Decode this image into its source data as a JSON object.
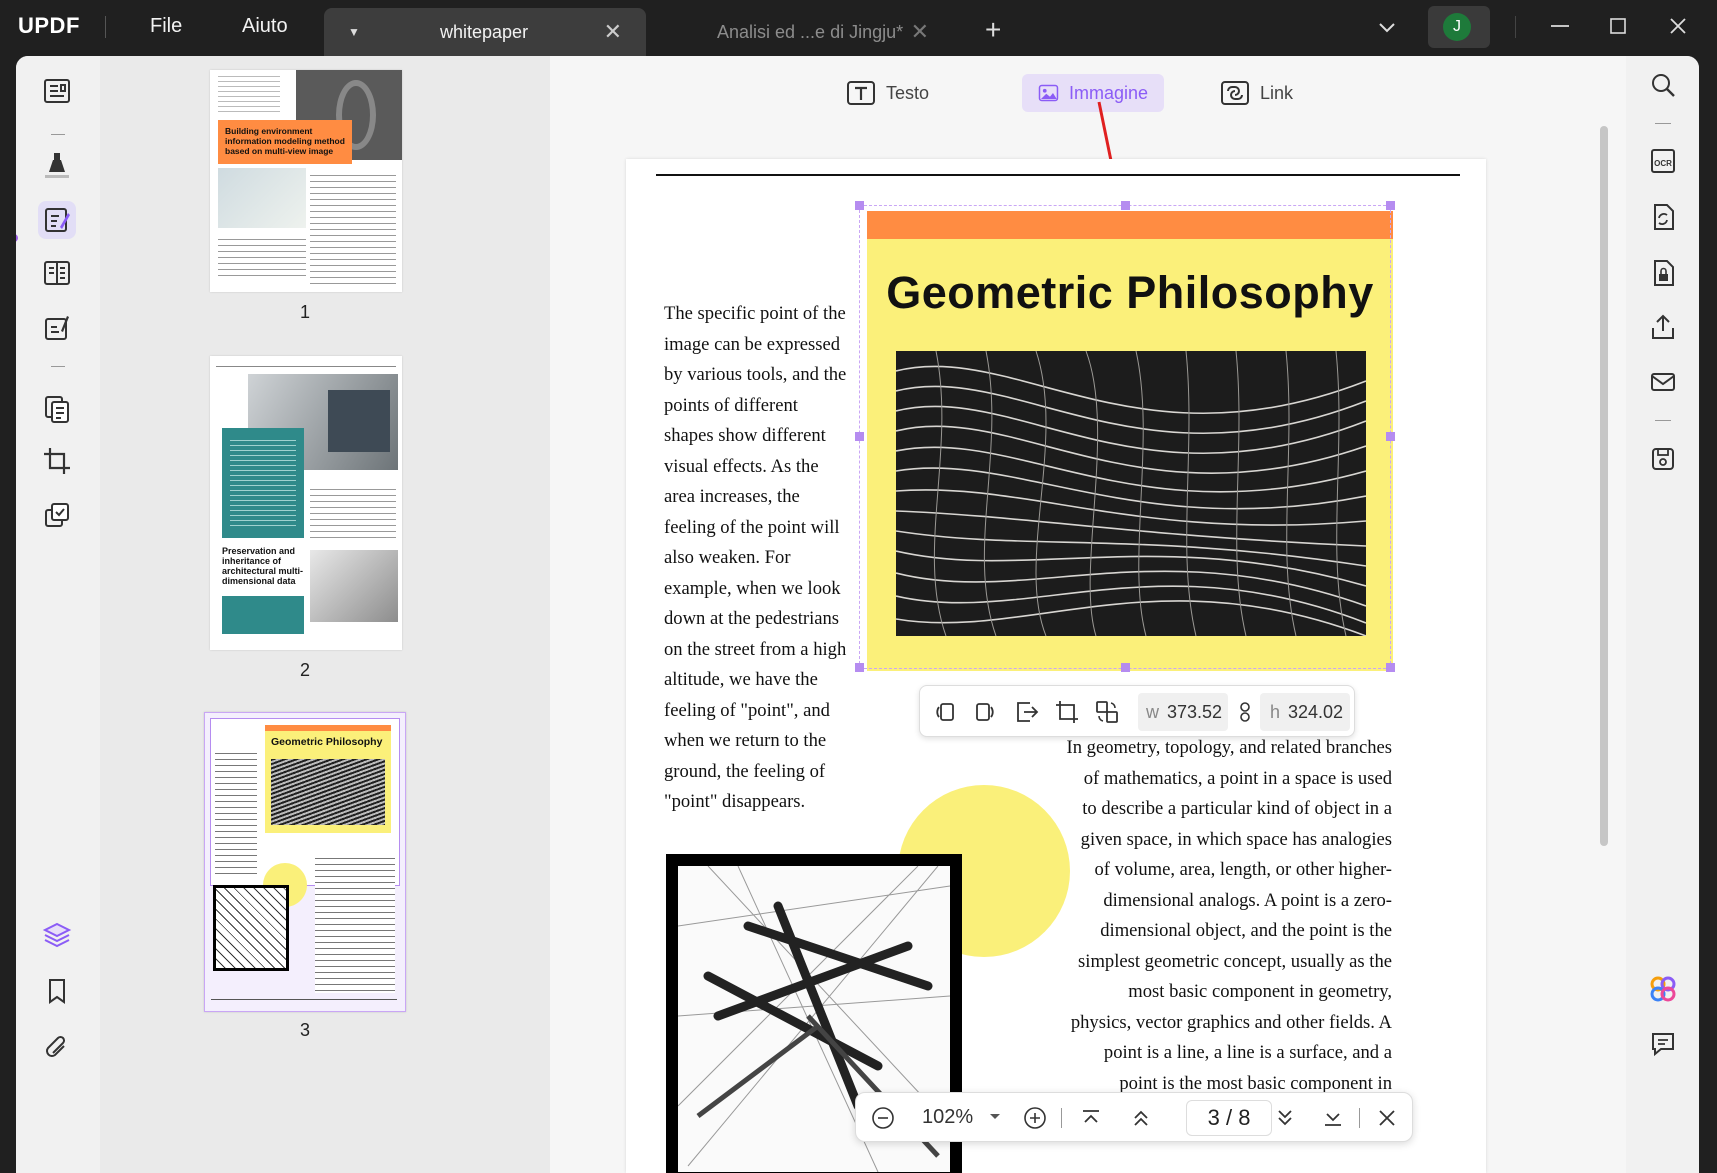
{
  "app": {
    "logo": "UPDF"
  },
  "menu": {
    "file": "File",
    "help": "Aiuto"
  },
  "tabs": [
    {
      "title": "whitepaper",
      "active": true
    },
    {
      "title": "Analisi ed ...e di Jingju*",
      "active": false
    }
  ],
  "user": {
    "initial": "J"
  },
  "edit_toolbar": {
    "text": "Testo",
    "image": "Immagine",
    "link": "Link"
  },
  "thumbnails": {
    "pages": [
      "1",
      "2",
      "3"
    ],
    "p1_caption": "Building environment information modeling method based on multi-view image",
    "p2_caption": "Preservation and inheritance of architectural multi-dimensional data",
    "p3_title": "Geometric Philosophy"
  },
  "document": {
    "card_title": "Geometric Philosophy",
    "left_paragraph": "The specific point of the image can be expressed by various tools, and the points of different shapes show different visual effects. As the area increases, the feeling of the point will also weaken. For example, when we look down at the pedestrians on the street from a high altitude, we have the feeling of \"point\", and when we return to the ground, the feeling of \"point\" disappears.",
    "right_paragraph": "In geometry, topology, and related branches of mathematics, a point in a space is used to describe a particular kind of object in a given space, in which space has analogies of volume, area, length, or other higher-dimensional analogs. A point is a zero-dimensional object, and the point is the simplest geometric concept, usually as the most basic component in geometry, physics, vector graphics and other fields. A point is a line, a line is a surface, and a point is the most basic component in geometry"
  },
  "image_toolbar": {
    "w_label": "w",
    "w_value": "373.52",
    "h_label": "h",
    "h_value": "324.02"
  },
  "zoom_bar": {
    "zoom": "102%",
    "current_page": "3",
    "separator": "/",
    "total_pages": "8"
  },
  "colors": {
    "accent": "#8b5cf6",
    "card_band": "#ff8c42",
    "card_bg": "#fbf07a",
    "teal": "#2f8a8a"
  }
}
